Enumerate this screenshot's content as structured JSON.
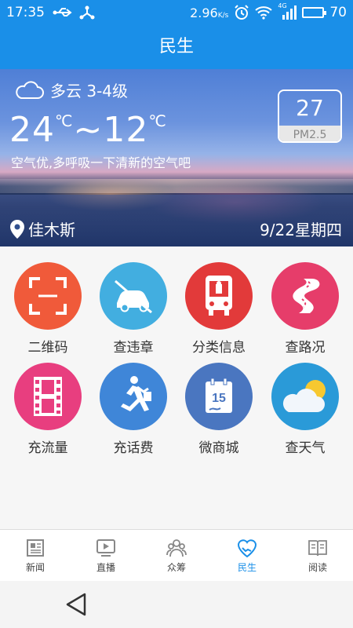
{
  "status": {
    "time": "17:35",
    "speed": "2.96",
    "speed_unit": "K/s",
    "network": "4G",
    "battery": "70",
    "battery_level": 0.7
  },
  "header": {
    "title": "民生"
  },
  "weather": {
    "condition": "多云 3-4级",
    "temp_high": "24",
    "temp_low": "12",
    "unit": "℃",
    "separator": "~",
    "air_quality": "空气优,多呼吸一下清新的空气吧",
    "pm_value": "27",
    "pm_label": "PM2.5",
    "city": "佳木斯",
    "date": "9/22星期四"
  },
  "tiles": [
    {
      "label": "二维码",
      "color": "#f05a3a"
    },
    {
      "label": "查违章",
      "color": "#42aee0"
    },
    {
      "label": "分类信息",
      "color": "#e23a3a"
    },
    {
      "label": "查路况",
      "color": "#e63d6a"
    },
    {
      "label": "充流量",
      "color": "#e83e7f"
    },
    {
      "label": "充话费",
      "color": "#3f86d8"
    },
    {
      "label": "微商城",
      "color": "#4a76c0"
    },
    {
      "label": "查天气",
      "color": "#2a9ad8"
    }
  ],
  "nav": [
    {
      "label": "新闻",
      "icon": "newspaper-icon"
    },
    {
      "label": "直播",
      "icon": "tv-icon"
    },
    {
      "label": "众筹",
      "icon": "people-icon"
    },
    {
      "label": "民生",
      "icon": "handshake-heart-icon",
      "active": true
    },
    {
      "label": "阅读",
      "icon": "book-icon"
    }
  ],
  "colors": {
    "accent": "#1a8fe8"
  }
}
